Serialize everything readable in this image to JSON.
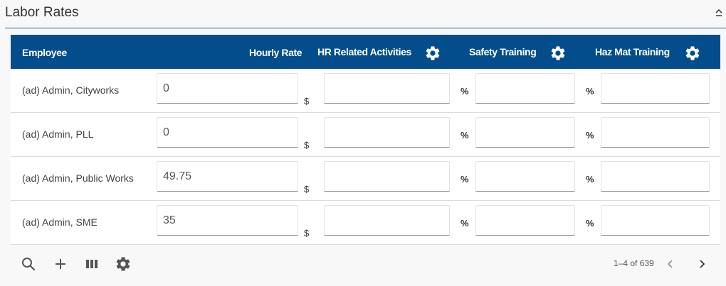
{
  "panel": {
    "title": "Labor Rates"
  },
  "columns": {
    "employee": "Employee",
    "hourly_rate": "Hourly Rate",
    "hr_related": "HR Related Activities",
    "safety": "Safety Training",
    "hazmat": "Haz Mat Training"
  },
  "units": {
    "dollar": "$",
    "percent": "%"
  },
  "rows": [
    {
      "employee": "(ad) Admin, Cityworks",
      "hourly_rate": "0",
      "hr_related": "",
      "safety": "",
      "hazmat": ""
    },
    {
      "employee": "(ad) Admin, PLL",
      "hourly_rate": "0",
      "hr_related": "",
      "safety": "",
      "hazmat": ""
    },
    {
      "employee": "(ad) Admin, Public Works",
      "hourly_rate": "49.75",
      "hr_related": "",
      "safety": "",
      "hazmat": ""
    },
    {
      "employee": "(ad) Admin, SME",
      "hourly_rate": "35",
      "hr_related": "",
      "safety": "",
      "hazmat": ""
    }
  ],
  "footer": {
    "icons": [
      "search-icon",
      "add-icon",
      "columns-icon",
      "gear-icon"
    ],
    "pagination": "1–4 of 639"
  },
  "colors": {
    "header_bg": "#044d8c",
    "accent_rule": "#1f5fa6"
  }
}
